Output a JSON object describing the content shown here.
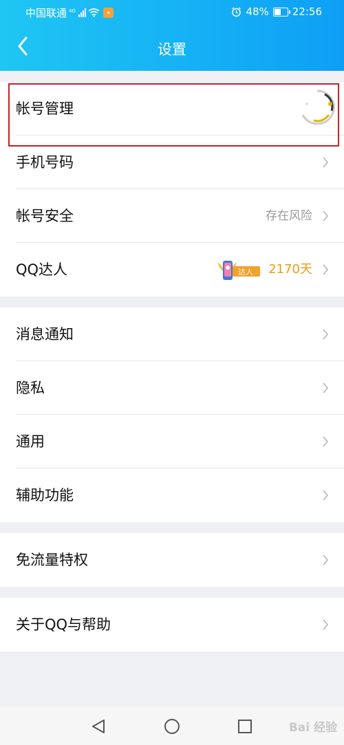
{
  "status": {
    "carrier": "中国联通",
    "network": "4G",
    "battery": "48%",
    "battery_level": 0.48,
    "time": "22:56"
  },
  "header": {
    "title": "设置",
    "back_icon": "chevron-left-icon"
  },
  "group1": [
    {
      "label": "帐号管理",
      "avatar": "avatar"
    },
    {
      "label": "手机号码",
      "value": ""
    },
    {
      "label": "帐号安全",
      "value": "存在风险"
    },
    {
      "label": "QQ达人",
      "badge_text": "达人",
      "value": "2170天"
    }
  ],
  "group2": [
    {
      "label": "消息通知"
    },
    {
      "label": "隐私"
    },
    {
      "label": "通用"
    },
    {
      "label": "辅助功能"
    }
  ],
  "group3": [
    {
      "label": "免流量特权"
    }
  ],
  "group4": [
    {
      "label": "关于QQ与帮助"
    }
  ],
  "nav": {
    "back_icon": "triangle-back-icon",
    "home_icon": "circle-home-icon",
    "recent_icon": "square-recent-icon"
  },
  "watermark": "Bai 经验",
  "colors": {
    "header_start": "#1fc6f3",
    "header_end": "#0e9ff5",
    "highlight": "#c4212b",
    "gold": "#e99a17"
  }
}
